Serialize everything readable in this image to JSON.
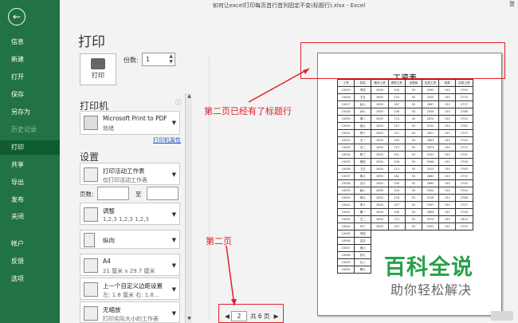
{
  "window": {
    "title": "如何让excel打印每页首行首列固定不变(标题行).xlsx  -  Excel",
    "right_text": "登"
  },
  "sidebar": {
    "items": [
      {
        "label": "信息"
      },
      {
        "label": "新建"
      },
      {
        "label": "打开"
      },
      {
        "label": "保存"
      },
      {
        "label": "另存为"
      },
      {
        "label": "历史记录"
      },
      {
        "label": "打印"
      },
      {
        "label": "共享"
      },
      {
        "label": "导出"
      },
      {
        "label": "发布"
      },
      {
        "label": "关闭"
      },
      {
        "label": "帐户"
      },
      {
        "label": "反馈"
      },
      {
        "label": "选项"
      }
    ]
  },
  "print": {
    "heading": "打印",
    "button_label": "打印",
    "copies_label": "份数:",
    "copies_value": "1"
  },
  "printer": {
    "section": "打印机",
    "name": "Microsoft Print to PDF",
    "status": "就绪",
    "properties_link": "打印机属性"
  },
  "settings": {
    "section": "设置",
    "scope_main": "打印活动工作表",
    "scope_sub": "仅打印活动工作表",
    "pages_label": "页数:",
    "to_label": "至",
    "collate_main": "调整",
    "collate_sub": "1,2,3    1,2,3    1,2,3",
    "orientation": "纵向",
    "paper_main": "A4",
    "paper_sub": "21 厘米 x 29.7 厘米",
    "margins_main": "上一个自定义边距设置",
    "margins_sub": "左: 1.8 厘米    右: 1.8...",
    "scaling_main": "无缩放",
    "scaling_sub": "打印实际大小的工作表"
  },
  "preview": {
    "page_title": "工资表",
    "headers": [
      "工号",
      "姓名",
      "基本工资",
      "绩效工资",
      "全勤奖",
      "应发工资",
      "扣款",
      "实发工资"
    ],
    "rows": [
      [
        "10025",
        "李四",
        "2650",
        "200",
        "50",
        "2900",
        "150",
        "2750"
      ],
      [
        "10026",
        "王五",
        "2650",
        "220",
        "50",
        "2920",
        "150",
        "2770"
      ],
      [
        "10027",
        "赵六",
        "2650",
        "187",
        "50",
        "2887",
        "150",
        "2737"
      ],
      [
        "10028",
        "孙七",
        "2650",
        "236",
        "50",
        "2936",
        "150",
        "2786"
      ],
      [
        "10029",
        "周八",
        "2650",
        "174",
        "50",
        "2874",
        "150",
        "2724"
      ],
      [
        "10030",
        "吴九",
        "2650",
        "212",
        "50",
        "2912",
        "150",
        "2762"
      ],
      [
        "10031",
        "郑十",
        "2650",
        "157",
        "50",
        "2857",
        "150",
        "2707"
      ],
      [
        "10032",
        "王一",
        "2650",
        "195",
        "50",
        "2895",
        "150",
        "2745"
      ],
      [
        "10033",
        "冯二",
        "2650",
        "173",
        "50",
        "2873",
        "150",
        "2723"
      ],
      [
        "10034",
        "陈三",
        "2650",
        "241",
        "50",
        "2941",
        "150",
        "2791"
      ],
      [
        "10035",
        "褚四",
        "2650",
        "206",
        "50",
        "2906",
        "150",
        "2756"
      ],
      [
        "10036",
        "卫五",
        "2650",
        "213",
        "50",
        "2913",
        "150",
        "2763"
      ],
      [
        "10037",
        "蒋六",
        "2650",
        "182",
        "50",
        "2882",
        "150",
        "2732"
      ],
      [
        "10038",
        "沈七",
        "2650",
        "190",
        "50",
        "2890",
        "150",
        "2740"
      ],
      [
        "10039",
        "韩八",
        "2650",
        "204",
        "50",
        "2904",
        "150",
        "2754"
      ],
      [
        "10040",
        "杨九",
        "2650",
        "218",
        "50",
        "2918",
        "150",
        "2768"
      ],
      [
        "10041",
        "朱十",
        "2650",
        "207",
        "50",
        "2907",
        "150",
        "2757"
      ],
      [
        "10042",
        "秦一",
        "2650",
        "196",
        "50",
        "2896",
        "150",
        "2746"
      ],
      [
        "10043",
        "尤二",
        "2650",
        "274",
        "50",
        "2974",
        "150",
        "2824"
      ],
      [
        "10044",
        "许三",
        "2650",
        "203",
        "50",
        "2903",
        "150",
        "2753"
      ]
    ],
    "partial_rows": [
      [
        "10045",
        "何四"
      ],
      [
        "10046",
        "吕五"
      ],
      [
        "10047",
        "施六"
      ],
      [
        "10048",
        "张七"
      ],
      [
        "10049",
        "孔八"
      ],
      [
        "10050",
        "曹九"
      ]
    ]
  },
  "pager": {
    "current": "2",
    "total": "共 6 页"
  },
  "annotations": {
    "header_note": "第二页已经有了标题行",
    "page_note": "第二页"
  },
  "watermark": {
    "main": "百科全说",
    "sub": "助你轻松解决"
  },
  "colors": {
    "sidebar": "#217346",
    "annotation": "#e0202a",
    "watermark": "#26a04a"
  }
}
